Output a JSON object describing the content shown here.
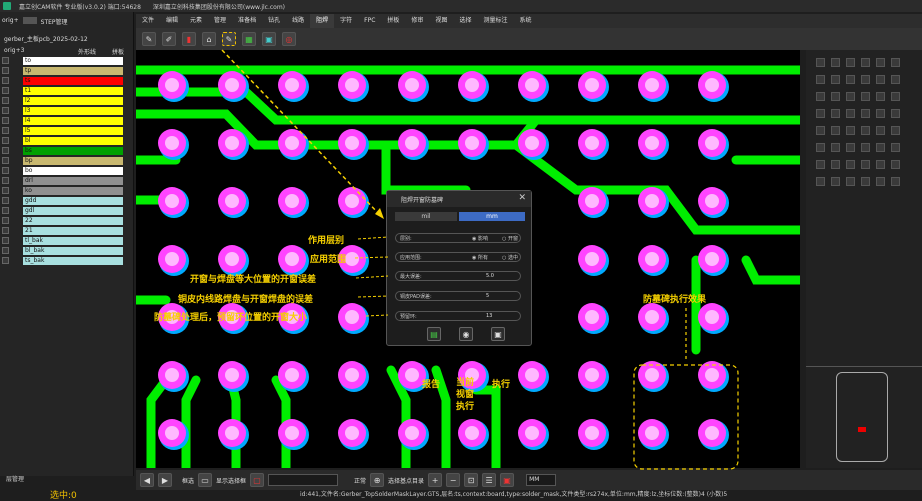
{
  "window": {
    "title": "嘉立创CAM软件 专业版(v3.0.2) 端口:54628",
    "company": "深圳嘉立创科技集团股份有限公司(www.jlc.com)"
  },
  "menu": [
    "文件",
    "编辑",
    "元素",
    "管理",
    "准备档",
    "钻孔",
    "线路",
    "阻焊",
    "字符",
    "FPC",
    "拼板",
    "修审",
    "视图",
    "选择",
    "测量标注",
    "系统"
  ],
  "menu_active": "阻焊",
  "left_panel": {
    "tab_orig": "orig+",
    "tab_step": "STEP管理",
    "job": "gerber_主板pcb_2025-02-12",
    "step": "orig+3",
    "chk_outline": "外形线",
    "chk_panel": "拼板",
    "layers": [
      {
        "name": "to",
        "color": "#ffffff"
      },
      {
        "name": "tp",
        "color": "#c8b870"
      },
      {
        "name": "ts",
        "color": "#ff0000"
      },
      {
        "name": "t1",
        "color": "#ffff00"
      },
      {
        "name": "l2",
        "color": "#ffff00"
      },
      {
        "name": "l3",
        "color": "#ffff00"
      },
      {
        "name": "l4",
        "color": "#ffff00"
      },
      {
        "name": "l5",
        "color": "#ffff00"
      },
      {
        "name": "bl",
        "color": "#ffff00"
      },
      {
        "name": "bs",
        "color": "#00a000"
      },
      {
        "name": "bp",
        "color": "#c8b870"
      },
      {
        "name": "bo",
        "color": "#ffffff"
      },
      {
        "name": "drl",
        "color": "#909090"
      },
      {
        "name": "ko",
        "color": "#909090"
      },
      {
        "name": "gdd",
        "color": "#a8e0e0"
      },
      {
        "name": "gdl",
        "color": "#a8e0e0"
      },
      {
        "name": "22",
        "color": "#a8e0e0"
      },
      {
        "name": "21",
        "color": "#a8e0e0"
      },
      {
        "name": "tl_bak",
        "color": "#a8e0e0"
      },
      {
        "name": "bl_bak",
        "color": "#a8e0e0"
      },
      {
        "name": "ts_bak",
        "color": "#a8e0e0"
      }
    ],
    "layer_manage": "层管理",
    "selected": "选中:0"
  },
  "dialog": {
    "title": "阻焊开窗防墓碑",
    "unit_mil": "mil",
    "unit_mm": "mm",
    "row1_label": "层别:",
    "row1_opt1": "影响",
    "row1_opt2": "开窗",
    "row2_label": "应用范围:",
    "row2_opt1": "所有",
    "row2_opt2": "选中",
    "row3_label": "最大误差:",
    "row3_value": "5.0",
    "row4_label": "铜皮PAD误差:",
    "row4_value": "5",
    "row5_label": "预留环:",
    "row5_value": "13"
  },
  "annotations": {
    "a1": "作用层别",
    "a2": "应用范围",
    "a3": "开窗与焊盘等大位置的开窗误差",
    "a4": "铜皮内线路焊盘与开窗焊盘的误差",
    "a5": "防墓碑处理后，预留环位置的开窗大小",
    "a6": "防墓碑执行效果",
    "b1": "报告",
    "b2": "当前视窗执行",
    "b3": "执行"
  },
  "bottom": {
    "mode": "框选",
    "display": "显示选择框",
    "mode2": "正常",
    "unit": "MM",
    "snap": "选择基点目录"
  },
  "status": "id:441,文件名:Gerber_TopSolderMaskLayer.GTS,层名:ts,context:board,type:solder_mask,文件类型:rs274x,单位:mm,精度:lz,坐标位数:(整数)4 (小数)5",
  "colors": {
    "trace": "#00ee00",
    "pad": "#ff44ff",
    "hole": "#ffb8ff",
    "mask_ring": "#00aaff",
    "annotation": "#f5d000"
  }
}
